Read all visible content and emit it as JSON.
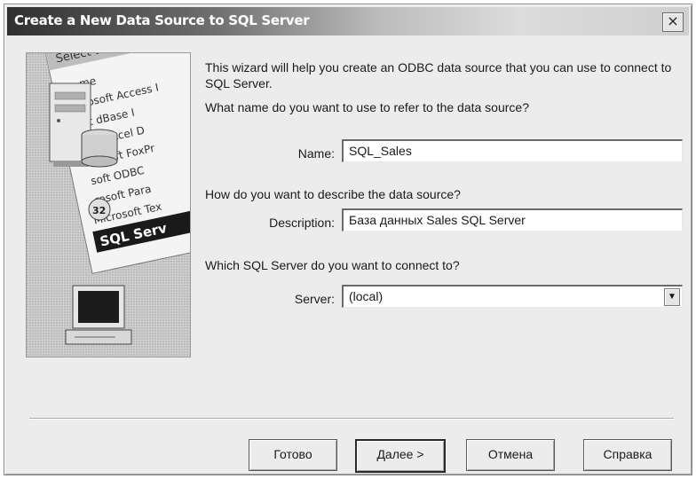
{
  "window": {
    "title": "Create a New Data Source to SQL Server",
    "close_label": "×"
  },
  "intro_text": "This wizard will help you create an ODBC data source that you can use to connect to SQL Server.",
  "questions": {
    "name_question": "What name do you want to use to refer to the data source?",
    "description_question": "How do you want to describe the data source?",
    "server_question": "Which SQL Server do you want to connect to?"
  },
  "fields": {
    "name_label": "Name:",
    "name_value": "SQL_Sales",
    "description_label": "Description:",
    "description_value": "База данных Sales SQL Server",
    "server_label": "Server:",
    "server_value": "(local)"
  },
  "illustration": {
    "header_text": "Select a driver fo",
    "drivers": [
      "me",
      "icrosoft Access I",
      "oft dBase I",
      "soft Excel D",
      "licrosoft FoxPr",
      "soft ODBC",
      "rosoft Para",
      "Microsoft Tex",
      "SQL Serv"
    ],
    "icons": [
      "server-tower-icon",
      "database-cylinder-icon",
      "computer-monitor-icon"
    ]
  },
  "buttons": {
    "finish": "Готово",
    "next": "Далее >",
    "cancel": "Отмена",
    "help": "Справка"
  }
}
